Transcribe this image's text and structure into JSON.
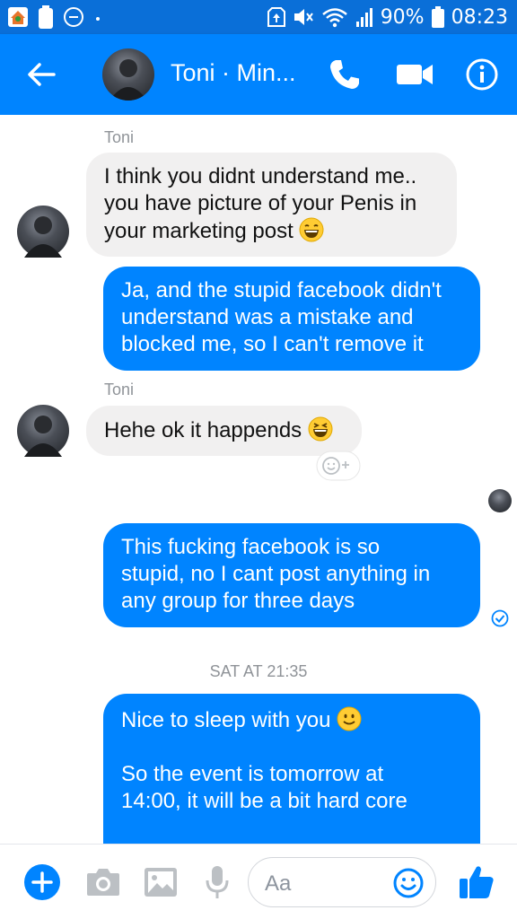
{
  "status_bar": {
    "battery": "90%",
    "time": "08:23"
  },
  "header": {
    "title": "Toni · Min..."
  },
  "messages": {
    "sender_1": "Toni",
    "m1_line1": "I think you didnt understand me..",
    "m1_line2": "you have picture of your Penis in",
    "m1_line3": "your marketing post",
    "m2_line1": "Ja, and the stupid facebook didn't",
    "m2_line2": "understand was a mistake and",
    "m2_line3": "blocked me, so I can't remove it",
    "sender_2": "Toni",
    "m3_line1": "Hehe ok it happends",
    "m4_line1": "This fucking facebook is so",
    "m4_line2": "stupid, no I cant post anything in",
    "m4_line3": "any group for three days",
    "date_separator": "SAT AT 21:35",
    "m5_line1": "Nice to sleep with you",
    "m5_line2": "So the event is tomorrow at",
    "m5_line3": "14:00, it will be a bit hard core"
  },
  "composer": {
    "placeholder": "Aa"
  },
  "colors": {
    "status_bar": "#0a6fd8",
    "header": "#0084ff",
    "outgoing_bubble": "#0084ff",
    "incoming_bubble": "#f1f0f0",
    "meta_text": "#8f9398"
  },
  "icons": [
    "home-notification-icon",
    "battery-notification-icon",
    "minus-circle-icon",
    "dot-icon",
    "storage-icon",
    "mute-icon",
    "wifi-icon",
    "signal-icon",
    "battery-icon",
    "back-arrow-icon",
    "phone-icon",
    "video-icon",
    "info-icon",
    "grin-emoji-icon",
    "laugh-emoji-icon",
    "add-reaction-icon",
    "seen-avatar-icon",
    "delivered-check-icon",
    "smile-emoji-icon",
    "plus-icon",
    "camera-icon",
    "image-icon",
    "microphone-icon",
    "emoji-icon",
    "thumbs-up-icon"
  ]
}
